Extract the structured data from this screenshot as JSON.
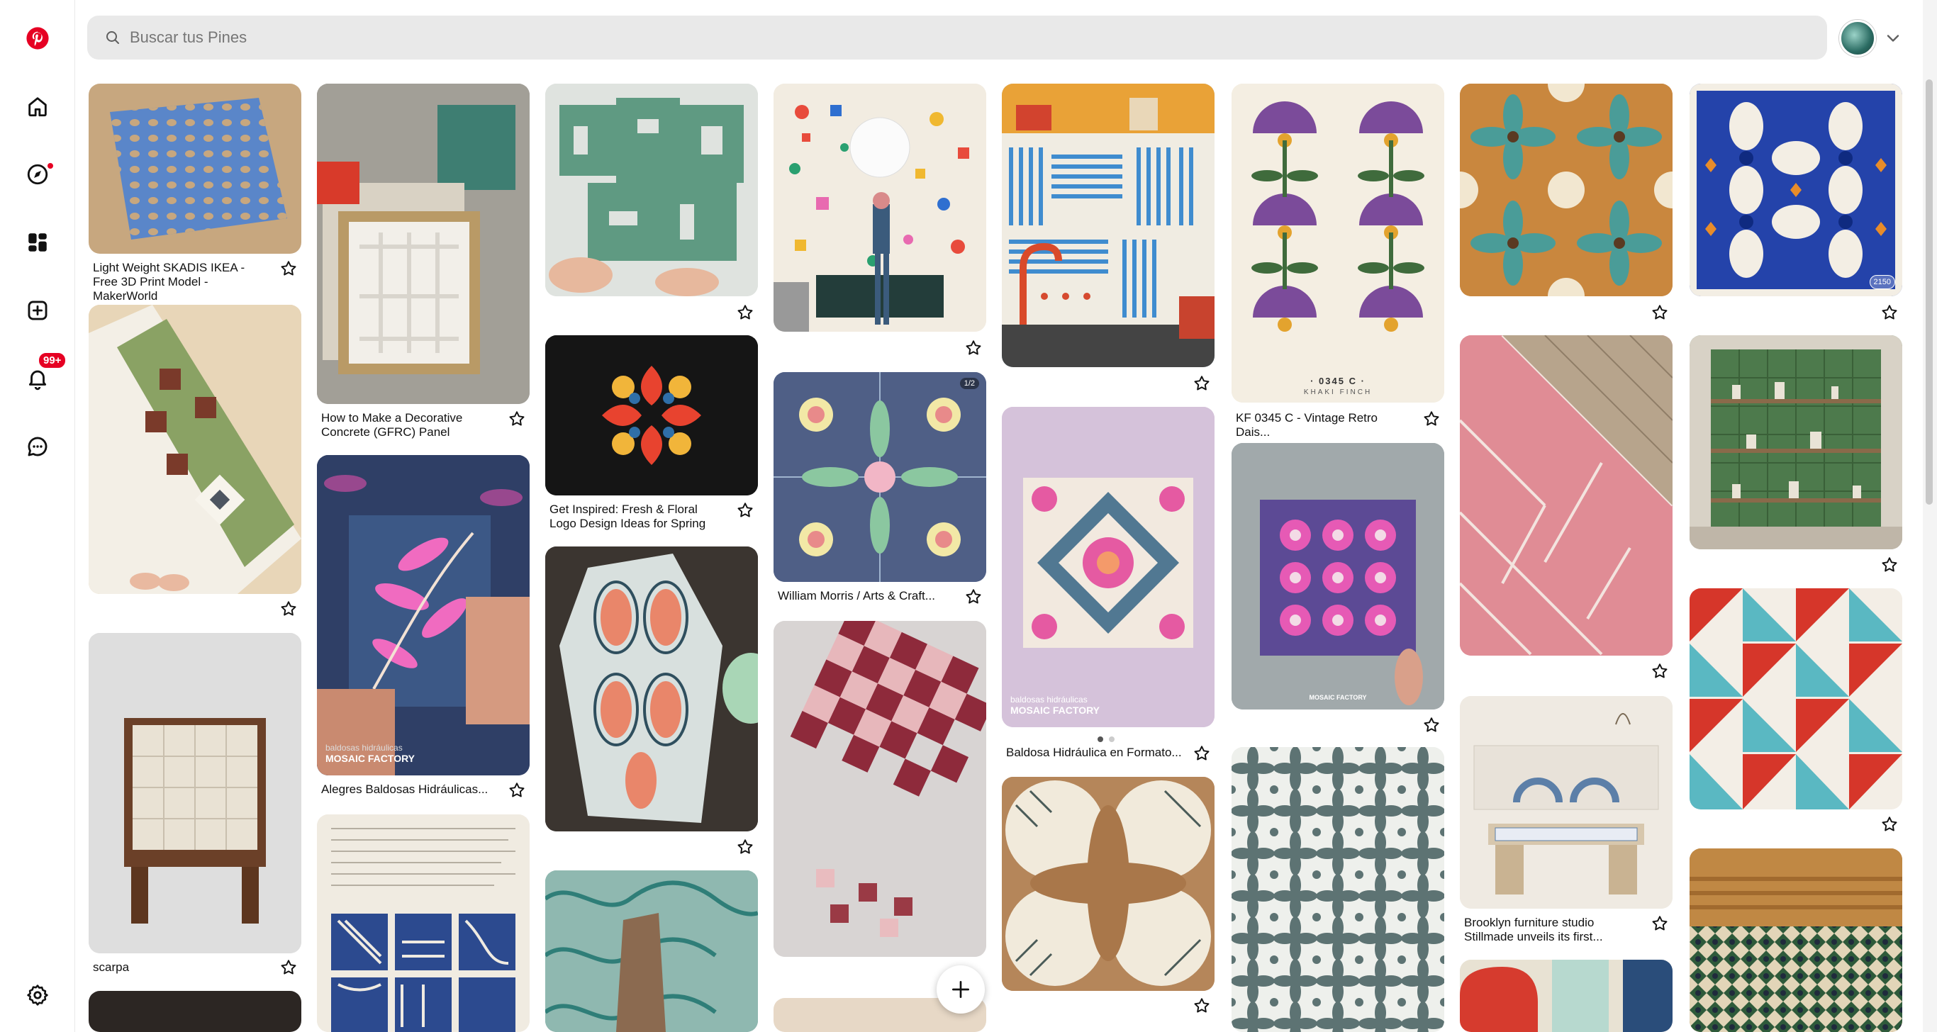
{
  "search": {
    "placeholder": "Buscar tus Pines"
  },
  "sidebar": {
    "notifications_badge": "99+"
  },
  "pins": {
    "p1": {
      "title": "Light Weight SKADIS IKEA - Free 3D Print Model - MakerWorld"
    },
    "p2": {
      "title": "How to Make a Decorative Concrete (GFRC) Panel"
    },
    "p3": {
      "title": "Get Inspired: Fresh & Floral Logo Design Ideas for Spring"
    },
    "p4": {
      "title": "William Morris / Arts & Craft..."
    },
    "p5": {
      "title": "Alegres Baldosas Hidráulicas..."
    },
    "p6": {
      "title": "Baldosa Hidráulica en Formato..."
    },
    "p7": {
      "title": "KF 0345 C - Vintage Retro Dais..."
    },
    "p8": {
      "title": "scarpa"
    },
    "p9": {
      "title": "Brooklyn furniture studio Stillmade unveils its first..."
    },
    "overlay_mosaic1": "MOSAIC FACTORY",
    "overlay_mosaic1_small": "baldosas hidráulicas",
    "overlay_mosaic2": "MOSAIC FACTORY",
    "overlay_mosaic2_small": "baldosas hidráulicas",
    "overlay_kf_code": "· 0345 C ·",
    "overlay_kf_name": "KHAKI FINCH",
    "overlay_count": "1/2",
    "overlay_2150": "2150",
    "overlay_mosaic3": "MOSAIC FACTORY"
  }
}
